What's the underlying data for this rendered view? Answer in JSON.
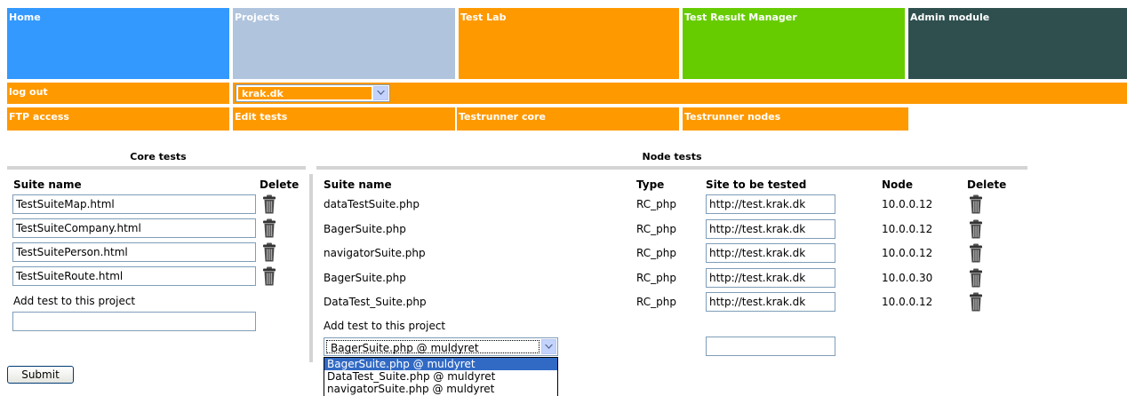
{
  "nav": {
    "tiles": [
      {
        "label": "Home",
        "color": "#3399ff"
      },
      {
        "label": "Projects",
        "color": "#b0c4de"
      },
      {
        "label": "Test Lab",
        "color": "#ff9900"
      },
      {
        "label": "Test Result Manager",
        "color": "#66cc00"
      },
      {
        "label": "Admin module",
        "color": "#2f4f4f"
      }
    ],
    "logout_label": "log out",
    "project_select_value": "krak.dk",
    "sub_items": [
      {
        "label": "FTP access"
      },
      {
        "label": "Edit tests"
      },
      {
        "label": "Testrunner core"
      },
      {
        "label": "Testrunner nodes"
      }
    ],
    "bar_color": "#ff9900"
  },
  "core": {
    "title": "Core tests",
    "headers": {
      "suite": "Suite name",
      "delete": "Delete"
    },
    "rows": [
      {
        "suite": "TestSuiteMap.html"
      },
      {
        "suite": "TestSuiteCompany.html"
      },
      {
        "suite": "TestSuitePerson.html"
      },
      {
        "suite": "TestSuiteRoute.html"
      }
    ],
    "add_label": "Add test to this project",
    "add_value": ""
  },
  "node": {
    "title": "Node tests",
    "headers": {
      "suite": "Suite name",
      "type": "Type",
      "site": "Site to be tested",
      "node": "Node",
      "delete": "Delete"
    },
    "rows": [
      {
        "suite": "dataTestSuite.php",
        "type": "RC_php",
        "site": "http://test.krak.dk",
        "node": "10.0.0.12"
      },
      {
        "suite": "BagerSuite.php",
        "type": "RC_php",
        "site": "http://test.krak.dk",
        "node": "10.0.0.12"
      },
      {
        "suite": "navigatorSuite.php",
        "type": "RC_php",
        "site": "http://test.krak.dk",
        "node": "10.0.0.12"
      },
      {
        "suite": "BagerSuite.php",
        "type": "RC_php",
        "site": "http://test.krak.dk",
        "node": "10.0.0.30"
      },
      {
        "suite": "DataTest_Suite.php",
        "type": "RC_php",
        "site": "http://test.krak.dk",
        "node": "10.0.0.12"
      }
    ],
    "add_label": "Add test to this project",
    "add_select_value": "BagerSuite.php @ muldyret",
    "add_site_value": "",
    "dropdown_options": [
      {
        "label": "BagerSuite.php @ muldyret",
        "selected": true
      },
      {
        "label": "DataTest_Suite.php @ muldyret",
        "selected": false
      },
      {
        "label": "navigatorSuite.php @ muldyret",
        "selected": false
      }
    ]
  },
  "submit_label": "Submit",
  "icons": {
    "trash": "trash-icon",
    "dropdown": "chevron-down-icon"
  }
}
